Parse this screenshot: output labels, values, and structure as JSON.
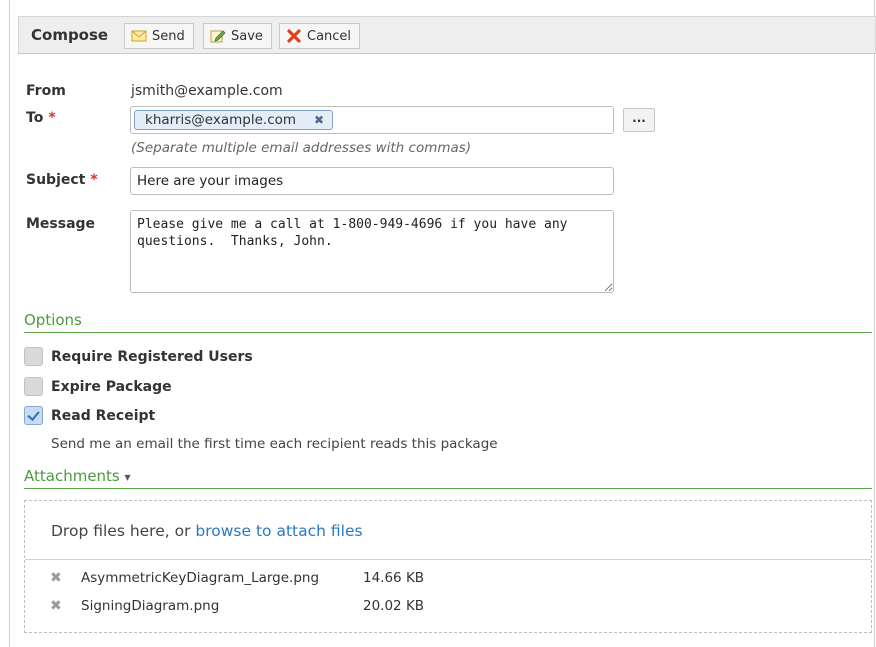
{
  "toolbar": {
    "title": "Compose",
    "send_label": "Send",
    "save_label": "Save",
    "cancel_label": "Cancel"
  },
  "form": {
    "from_label": "From",
    "from_value": "jsmith@example.com",
    "to_label": "To",
    "required_mark": "*",
    "to_recipients": [
      "kharris@example.com"
    ],
    "remove_chip": "✖",
    "browse_button": "...",
    "to_hint": "(Separate multiple email addresses with commas)",
    "subject_label": "Subject",
    "subject_value": "Here are your images",
    "message_label": "Message",
    "message_value": "Please give me a call at 1-800-949-4696 if you have any\nquestions.  Thanks, John."
  },
  "options": {
    "section_title": "Options",
    "items": [
      {
        "label": "Require Registered Users",
        "checked": false
      },
      {
        "label": "Expire Package",
        "checked": false
      },
      {
        "label": "Read Receipt",
        "checked": true
      }
    ],
    "read_receipt_description": "Send me an email the first time each recipient reads this package"
  },
  "attachments": {
    "section_title": "Attachments",
    "dropdown_arrow": "▾",
    "drop_text": "Drop files here, or ",
    "browse_link": "browse to attach files",
    "remove_icon": "✖",
    "files": [
      {
        "name": "AsymmetricKeyDiagram_Large.png",
        "size": "14.66 KB"
      },
      {
        "name": "SigningDiagram.png",
        "size": "20.02 KB"
      }
    ]
  },
  "colors": {
    "section_green": "#4b9a3c",
    "link_blue": "#2a78c5",
    "required_red": "#d9302c"
  }
}
